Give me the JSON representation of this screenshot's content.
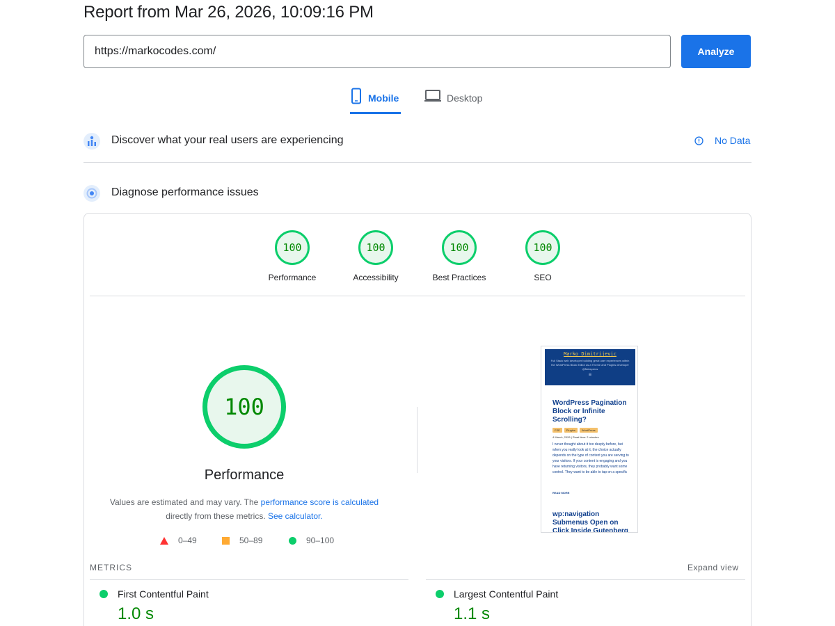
{
  "report": {
    "title": "Report from Mar 26, 2026, 10:09:16 PM"
  },
  "search": {
    "url": "https://markocodes.com/",
    "analyze_label": "Analyze"
  },
  "tabs": [
    {
      "label": "Mobile",
      "icon": "phone-icon",
      "active": true
    },
    {
      "label": "Desktop",
      "icon": "laptop-icon",
      "active": false
    }
  ],
  "crux": {
    "title": "Discover what your real users are experiencing",
    "status": "No Data"
  },
  "diagnose": {
    "title": "Diagnose performance issues"
  },
  "scores": [
    {
      "label": "Performance",
      "value": "100"
    },
    {
      "label": "Accessibility",
      "value": "100"
    },
    {
      "label": "Best Practices",
      "value": "100"
    },
    {
      "label": "SEO",
      "value": "100"
    }
  ],
  "performance": {
    "score": "100",
    "label": "Performance",
    "note_text_1": "Values are estimated and may vary. The ",
    "note_link_1": "performance score is calculated",
    "note_text_2": "directly from these metrics. ",
    "note_link_2": "See calculator."
  },
  "legend": [
    {
      "range": "0–49",
      "color": "#ff3333",
      "shape": "triangle"
    },
    {
      "range": "50–89",
      "color": "#ffaa33",
      "shape": "square"
    },
    {
      "range": "90–100",
      "color": "#0cce6b",
      "shape": "circle"
    }
  ],
  "screenshot": {
    "site_name": "Marko Dimitrijevic",
    "tagline": "Full Stack web developer building great user experiences within the WordPress Block Editor as a Theme and Plugins developer @Melapress",
    "menu": "☰",
    "article_title": "WordPress Pagination Block or Infinite Scrolling?",
    "tags": [
      "FSE",
      "Plugins",
      "WordPress"
    ],
    "meta": "4 March, 2026 | Read time: 2 minutes",
    "body": "I never thought about it too deeply before, but when you really look at it, the choice actually depends on the type of content you are serving to your visitors. If your content is engaging and you have returning visitors, they probably want some control. They want to be able to tap on a specific",
    "read_more": "READ MORE",
    "article_title_2": "wp:navigation Submenus Open on Click Inside Gutenberg"
  },
  "metrics": {
    "section_label": "METRICS",
    "expand_label": "Expand view",
    "items": [
      {
        "name": "First Contentful Paint",
        "value": "1.0 s"
      },
      {
        "name": "Largest Contentful Paint",
        "value": "1.1 s"
      }
    ]
  },
  "colors": {
    "accent": "#1a73e8",
    "pass": "#0cce6b",
    "pass_text": "#008800"
  }
}
